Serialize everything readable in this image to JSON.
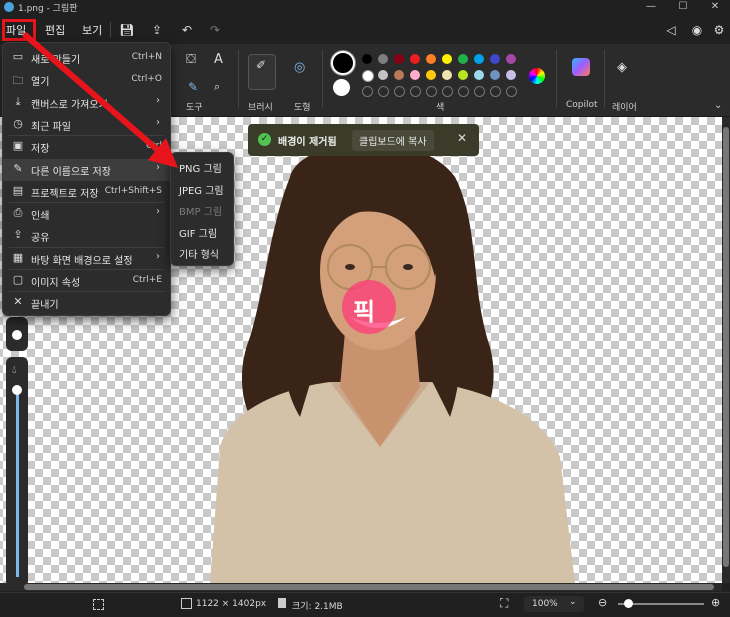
{
  "titlebar": {
    "title": "1.png - 그림판"
  },
  "menubar": {
    "items": [
      "파일",
      "편집",
      "보기"
    ]
  },
  "ribbon": {
    "tools_label": "도구",
    "brushes_label": "브러시",
    "shapes_label": "도형",
    "colors_label": "색",
    "copilot_label": "Copilot",
    "layers_label": "레이어",
    "palette_row1": [
      "#000000",
      "#7f7f7f",
      "#880015",
      "#ed1c24",
      "#ff7f27",
      "#fff200",
      "#22b14c",
      "#00a2e8",
      "#3f48cc",
      "#a349a4"
    ],
    "palette_row2": [
      "#ffffff",
      "#c3c3c3",
      "#b97a57",
      "#ffaec9",
      "#ffc90e",
      "#efe4b0",
      "#b5e61d",
      "#99d9ea",
      "#7092be",
      "#c8bfe7"
    ]
  },
  "notification": {
    "message": "배경이 제거됨",
    "action": "클립보드에 복사"
  },
  "file_menu": {
    "items": [
      {
        "label": "새로 만들기",
        "shortcut": "Ctrl+N",
        "icon": "new-file-icon"
      },
      {
        "label": "열기",
        "shortcut": "Ctrl+O",
        "icon": "folder-open-icon"
      },
      {
        "label": "캔버스로 가져오기",
        "shortcut": "",
        "icon": "import-icon"
      },
      {
        "label": "최근 파일",
        "shortcut": "",
        "icon": "clock-icon"
      },
      {
        "label": "저장",
        "shortcut": "Ctrl",
        "icon": "save-icon"
      },
      {
        "label": "다른 이름으로 저장",
        "shortcut": "",
        "icon": "save-as-icon"
      },
      {
        "label": "프로젝트로 저장",
        "shortcut": "Ctrl+Shift+S",
        "icon": "project-save-icon"
      },
      {
        "label": "인쇄",
        "shortcut": "",
        "icon": "print-icon"
      },
      {
        "label": "공유",
        "shortcut": "",
        "icon": "share-icon"
      },
      {
        "label": "바탕 화면 배경으로 설정",
        "shortcut": "",
        "icon": "wallpaper-icon"
      },
      {
        "label": "이미지 속성",
        "shortcut": "Ctrl+E",
        "icon": "properties-icon"
      },
      {
        "label": "끝내기",
        "shortcut": "",
        "icon": "close-icon"
      }
    ]
  },
  "submenu": {
    "items": [
      "PNG 그림",
      "JPEG 그림",
      "BMP 그림",
      "GIF 그림",
      "기타 형식"
    ]
  },
  "stamp_text": "픽",
  "statusbar": {
    "dimensions": "1122 × 1402px",
    "size": "크기: 2.1MB",
    "zoom": "100%"
  }
}
